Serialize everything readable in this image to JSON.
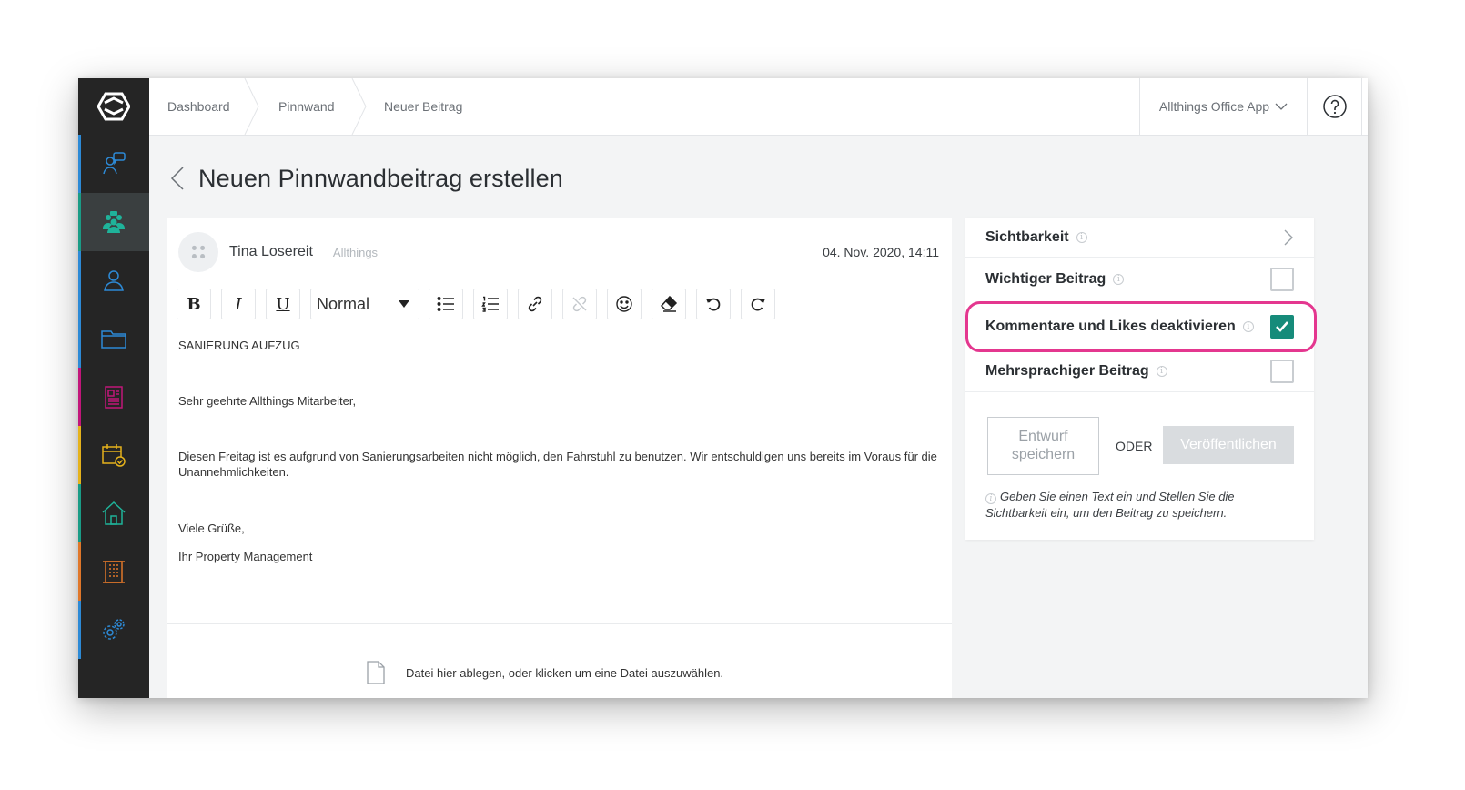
{
  "breadcrumbs": [
    {
      "label": "Dashboard"
    },
    {
      "label": "Pinnwand"
    },
    {
      "label": "Neuer Beitrag"
    }
  ],
  "topbar": {
    "app_switcher": "Allthings Office App"
  },
  "sidebar": {
    "items": [
      {
        "icon": "chat-icon",
        "color": "#2d8ad6"
      },
      {
        "icon": "community-icon",
        "color": "#1a9c86",
        "active": true
      },
      {
        "icon": "person-icon",
        "color": "#2d8ad6"
      },
      {
        "icon": "folder-icon",
        "color": "#2d8ad6"
      },
      {
        "icon": "document-icon",
        "color": "#c2167a"
      },
      {
        "icon": "calendar-check-icon",
        "color": "#e5b21c"
      },
      {
        "icon": "home-icon",
        "color": "#1a9c86"
      },
      {
        "icon": "building-icon",
        "color": "#e0772a"
      },
      {
        "icon": "settings-icon",
        "color": "#2d8ad6"
      }
    ]
  },
  "page": {
    "title": "Neuen Pinnwandbeitrag erstellen"
  },
  "editor": {
    "author_name": "Tina Losereit",
    "author_org": "Allthings",
    "date": "04. Nov. 2020, 14:11",
    "toolbar": {
      "bold": "B",
      "italic": "I",
      "underline": "U",
      "format_select": "Normal"
    },
    "body": {
      "line1": "SANIERUNG AUFZUG",
      "line2": "Sehr geehrte Allthings Mitarbeiter,",
      "line3": "Diesen Freitag ist es aufgrund von Sanierungsarbeiten nicht möglich, den Fahrstuhl zu benutzen. Wir entschuldigen uns bereits im Voraus für die Unannehmlichkeiten.",
      "line4": "Viele Grüße,",
      "line5": "Ihr Property Management"
    },
    "dropzone": "Datei hier ablegen, oder klicken um eine Datei auszuwählen."
  },
  "settings": {
    "visibility": "Sichtbarkeit",
    "important": {
      "label": "Wichtiger Beitrag",
      "checked": false
    },
    "disable_comments": {
      "label": "Kommentare und Likes deaktivieren",
      "checked": true
    },
    "multilingual": {
      "label": "Mehrsprachiger Beitrag",
      "checked": false
    },
    "draft_button": "Entwurf speichern",
    "or_label": "ODER",
    "publish_button": "Veröffentlichen",
    "hint": "Geben Sie einen Text ein und Stellen Sie die Sichtbarkeit ein, um den Beitrag zu speichern."
  },
  "colors": {
    "accent_teal": "#168b7a",
    "highlight_pink": "#e4378f",
    "sidebar_bg": "#252525"
  }
}
